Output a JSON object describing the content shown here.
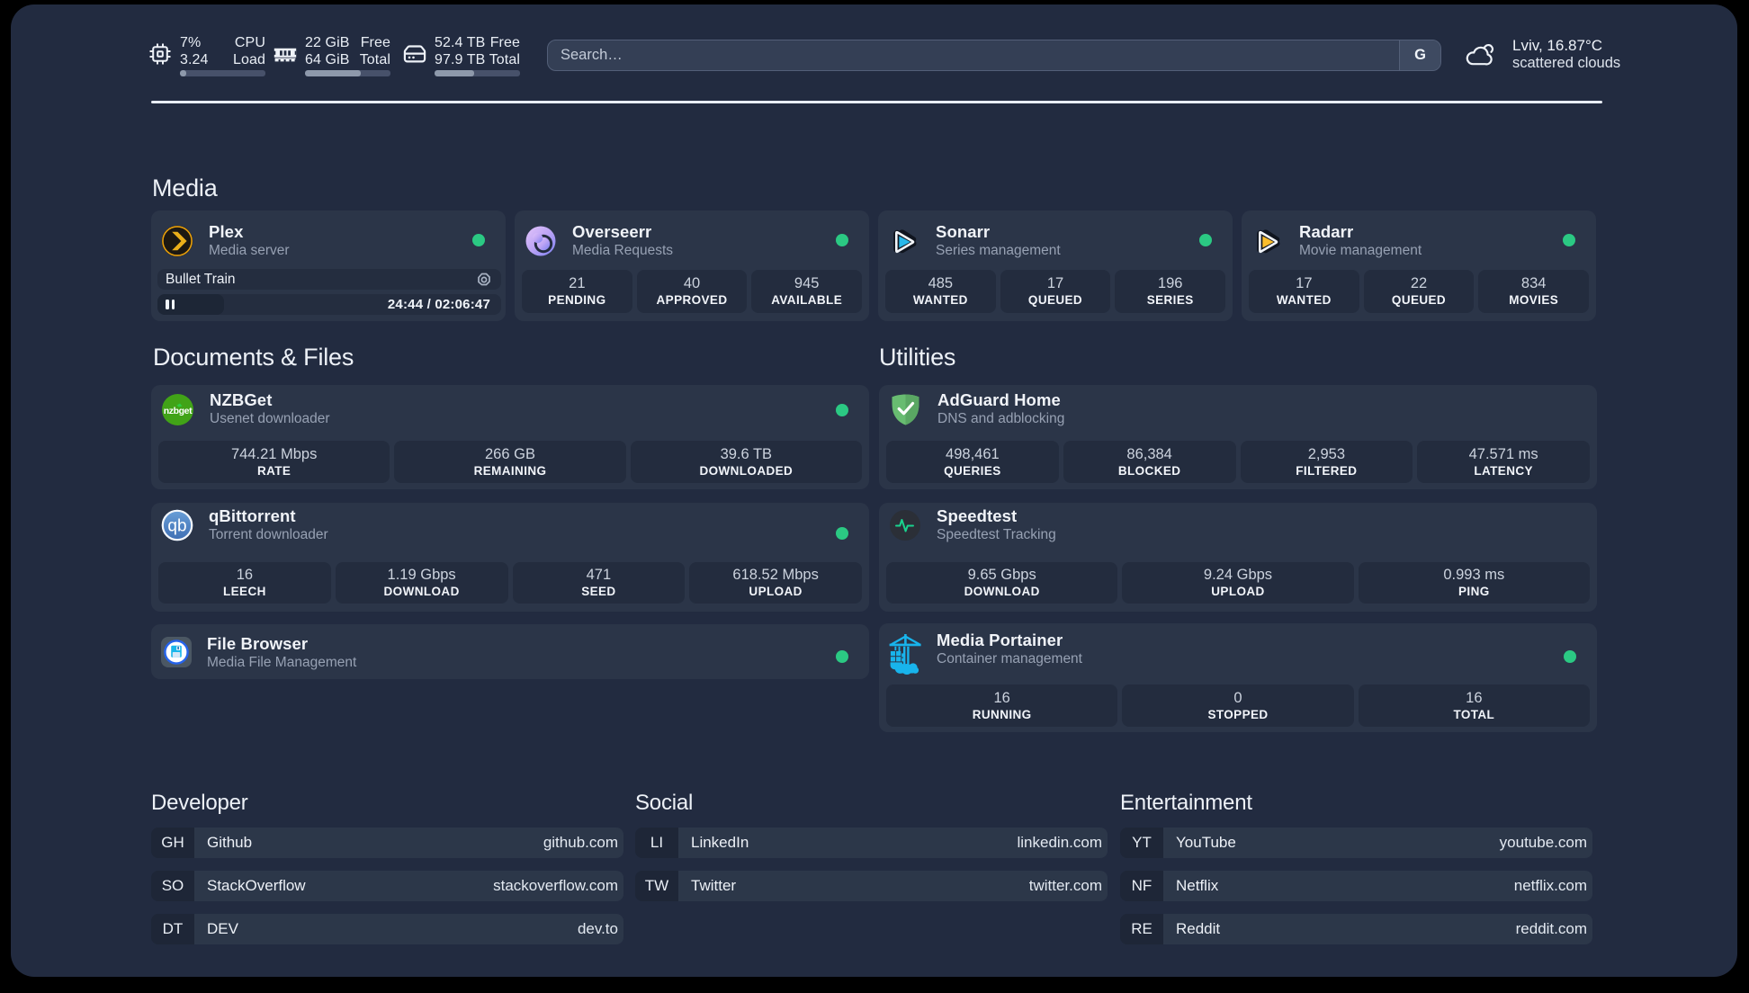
{
  "topbar": {
    "resources": [
      {
        "name": "cpu",
        "icon": "cpu-icon",
        "rows": [
          {
            "value": "7%",
            "label": "CPU"
          },
          {
            "value": "3.24",
            "label": "Load"
          }
        ],
        "progress_percent": 7
      },
      {
        "name": "memory",
        "icon": "memory-icon",
        "rows": [
          {
            "value": "22 GiB",
            "label": "Free"
          },
          {
            "value": "64 GiB",
            "label": "Total"
          }
        ],
        "progress_percent": 65.6
      },
      {
        "name": "disk",
        "icon": "disk-icon",
        "rows": [
          {
            "value": "52.4 TB",
            "label": "Free"
          },
          {
            "value": "97.9 TB",
            "label": "Total"
          }
        ],
        "progress_percent": 46.5
      }
    ],
    "search": {
      "placeholder": "Search…",
      "provider": "G"
    },
    "weather": {
      "location": "Lviv, 16.87°C",
      "condition": "scattered clouds",
      "icon": "scattered-clouds-icon"
    }
  },
  "sections": {
    "media": {
      "heading": "Media",
      "plex": {
        "title": "Plex",
        "subtitle": "Media server",
        "status": "online",
        "now_playing": {
          "media_title": "Bullet Train",
          "time": "24:44 / 02:06:47",
          "progress_percent": 19.5
        }
      },
      "overseerr": {
        "title": "Overseerr",
        "subtitle": "Media Requests",
        "status": "online",
        "stats": [
          {
            "value": "21",
            "label": "PENDING"
          },
          {
            "value": "40",
            "label": "APPROVED"
          },
          {
            "value": "945",
            "label": "AVAILABLE"
          }
        ]
      },
      "sonarr": {
        "title": "Sonarr",
        "subtitle": "Series management",
        "status": "online",
        "stats": [
          {
            "value": "485",
            "label": "WANTED"
          },
          {
            "value": "17",
            "label": "QUEUED"
          },
          {
            "value": "196",
            "label": "SERIES"
          }
        ]
      },
      "radarr": {
        "title": "Radarr",
        "subtitle": "Movie management",
        "status": "online",
        "stats": [
          {
            "value": "17",
            "label": "WANTED"
          },
          {
            "value": "22",
            "label": "QUEUED"
          },
          {
            "value": "834",
            "label": "MOVIES"
          }
        ]
      }
    },
    "documents": {
      "heading": "Documents & Files",
      "nzbget": {
        "title": "NZBGet",
        "subtitle": "Usenet downloader",
        "status": "online",
        "stats": [
          {
            "value": "744.21 Mbps",
            "label": "RATE"
          },
          {
            "value": "266 GB",
            "label": "REMAINING"
          },
          {
            "value": "39.6 TB",
            "label": "DOWNLOADED"
          }
        ]
      },
      "qbittorrent": {
        "title": "qBittorrent",
        "subtitle": "Torrent downloader",
        "status": "online",
        "stats": [
          {
            "value": "16",
            "label": "LEECH"
          },
          {
            "value": "1.19 Gbps",
            "label": "DOWNLOAD"
          },
          {
            "value": "471",
            "label": "SEED"
          },
          {
            "value": "618.52 Mbps",
            "label": "UPLOAD"
          }
        ]
      },
      "filebrowser": {
        "title": "File Browser",
        "subtitle": "Media File Management",
        "status": "online"
      }
    },
    "utilities": {
      "heading": "Utilities",
      "adguard": {
        "title": "AdGuard Home",
        "subtitle": "DNS and adblocking",
        "stats": [
          {
            "value": "498,461",
            "label": "QUERIES"
          },
          {
            "value": "86,384",
            "label": "BLOCKED"
          },
          {
            "value": "2,953",
            "label": "FILTERED"
          },
          {
            "value": "47.571 ms",
            "label": "LATENCY"
          }
        ]
      },
      "speedtest": {
        "title": "Speedtest",
        "subtitle": "Speedtest Tracking",
        "stats": [
          {
            "value": "9.65 Gbps",
            "label": "DOWNLOAD"
          },
          {
            "value": "9.24 Gbps",
            "label": "UPLOAD"
          },
          {
            "value": "0.993 ms",
            "label": "PING"
          }
        ]
      },
      "portainer": {
        "title": "Media Portainer",
        "subtitle": "Container management",
        "status": "online",
        "stats": [
          {
            "value": "16",
            "label": "RUNNING"
          },
          {
            "value": "0",
            "label": "STOPPED"
          },
          {
            "value": "16",
            "label": "TOTAL"
          }
        ]
      }
    },
    "bookmarks": [
      {
        "heading": "Developer",
        "items": [
          {
            "abbr": "GH",
            "name": "Github",
            "url": "github.com"
          },
          {
            "abbr": "SO",
            "name": "StackOverflow",
            "url": "stackoverflow.com"
          },
          {
            "abbr": "DT",
            "name": "DEV",
            "url": "dev.to"
          }
        ]
      },
      {
        "heading": "Social",
        "items": [
          {
            "abbr": "LI",
            "name": "LinkedIn",
            "url": "linkedin.com"
          },
          {
            "abbr": "TW",
            "name": "Twitter",
            "url": "twitter.com"
          }
        ]
      },
      {
        "heading": "Entertainment",
        "items": [
          {
            "abbr": "YT",
            "name": "YouTube",
            "url": "youtube.com"
          },
          {
            "abbr": "NF",
            "name": "Netflix",
            "url": "netflix.com"
          },
          {
            "abbr": "RE",
            "name": "Reddit",
            "url": "reddit.com"
          }
        ]
      }
    ]
  }
}
